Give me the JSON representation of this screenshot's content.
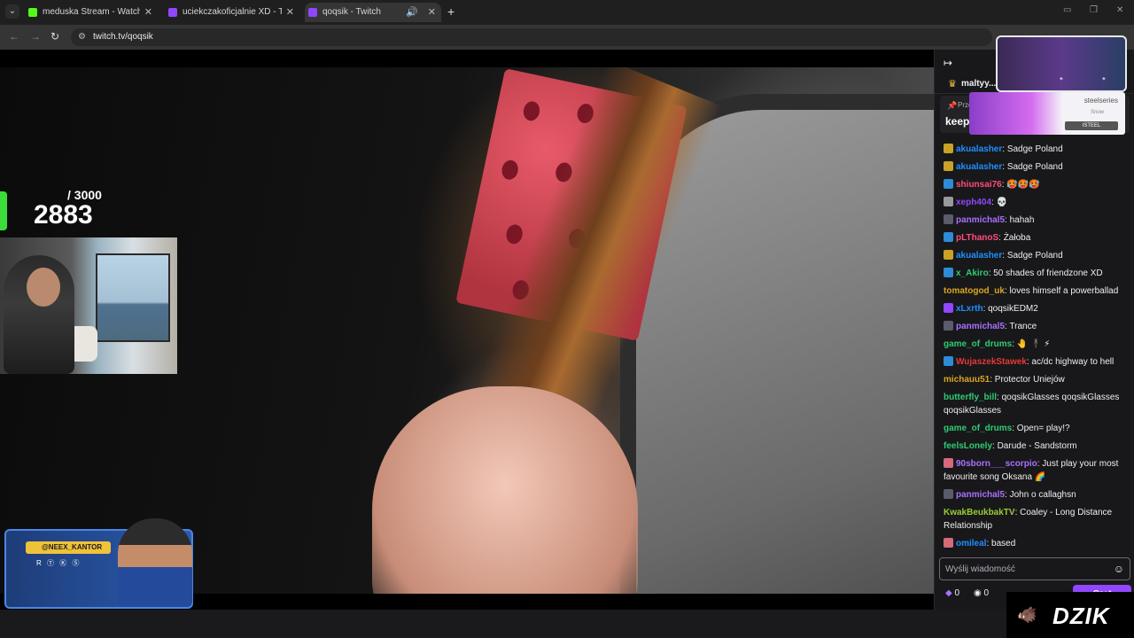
{
  "browser": {
    "tabs": [
      {
        "title": "meduska Stream - Watch Live o",
        "favicon_color": "#53fc18"
      },
      {
        "title": "uciekczakoficjalnie XD - Twitch",
        "favicon_color": "#9146ff"
      },
      {
        "title": "qoqsik - Twitch",
        "favicon_color": "#9146ff"
      }
    ],
    "url": "twitch.tv/qoqsik",
    "tab_menu_icon": "chevron-down-icon",
    "close_glyph": "✕",
    "new_tab_glyph": "+"
  },
  "stream": {
    "counter_total": "/ 3000",
    "counter_value": "2883",
    "overlay_handle": "@NEEX_KANTOR"
  },
  "chat": {
    "top_gifter": "maltyy...",
    "pinned_label": "Prze",
    "pinned_text": "keep",
    "ad": {
      "brand": "steelseries",
      "sub": "Snow",
      "button": "ISTEEL"
    },
    "messages": [
      {
        "badge": "b-gift",
        "user": "akualasher",
        "color": "#1e90ff",
        "text": ": Sadge Poland"
      },
      {
        "badge": "b-gift",
        "user": "akualasher",
        "color": "#1e90ff",
        "text": ": Sadge Poland"
      },
      {
        "badge": "b-prime",
        "user": "shiunsai76",
        "color": "#ff4d7a",
        "text": ": 🥵🥵🥵"
      },
      {
        "badge": "b-skull",
        "user": "xeph404",
        "color": "#9146ff",
        "text": ": 💀"
      },
      {
        "badge": "b-sub",
        "user": "panmichal5",
        "color": "#a970ff",
        "text": ": hahah"
      },
      {
        "badge": "b-prime",
        "user": "pLThanoS",
        "color": "#ff4d7a",
        "text": ": Żałoba"
      },
      {
        "badge": "b-gift",
        "user": "akualasher",
        "color": "#1e90ff",
        "text": ": Sadge Poland"
      },
      {
        "badge": "b-prime",
        "user": "x_Akiro",
        "color": "#2ecc71",
        "text": ": 50 shades of friendzone XD"
      },
      {
        "badge": "",
        "user": "tomatogod_uk",
        "color": "#daa520",
        "text": ": loves himself a powerballad"
      },
      {
        "badge": "b-verify",
        "user": "xLxrth",
        "color": "#1e90ff",
        "text": ": qoqsikEDM2"
      },
      {
        "badge": "b-sub",
        "user": "panmichal5",
        "color": "#a970ff",
        "text": ": Trance"
      },
      {
        "badge": "",
        "user": "game_of_drums",
        "color": "#2ecc71",
        "text": ": 🤚 🕴️ ⚡"
      },
      {
        "badge": "b-prime",
        "user": "WujaszekStawek",
        "color": "#e53935",
        "text": ": ac/dc highway to hell"
      },
      {
        "badge": "",
        "user": "michauu51",
        "color": "#daa520",
        "text": ": Protector Uniejów"
      },
      {
        "badge": "",
        "user": "butterfly_bill",
        "color": "#2ecc71",
        "text": ": qoqsikGlasses qoqsikGlasses qoqsikGlasses"
      },
      {
        "badge": "",
        "user": "game_of_drums",
        "color": "#2ecc71",
        "text": ": Open= play!?"
      },
      {
        "badge": "",
        "user": "feelsLonely",
        "color": "#2ecc71",
        "text": ": Darude - Sandstorm"
      },
      {
        "badge": "b-pink",
        "user": "90sborn___scorpio",
        "color": "#a970ff",
        "text": ": Just play your most favourite song Oksana 🌈"
      },
      {
        "badge": "b-sub",
        "user": "panmichal5",
        "color": "#a970ff",
        "text": ": John o callaghsn"
      },
      {
        "badge": "",
        "user": "KwakBeukbakTV",
        "color": "#9acd32",
        "text": ": Coaley - Long Distance Relationship"
      },
      {
        "badge": "b-pink",
        "user": "omileal",
        "color": "#1e90ff",
        "text": ": based"
      }
    ],
    "input_placeholder": "Wyślij wiadomość",
    "points_a": "0",
    "points_b": "0",
    "send_label": "Czat"
  },
  "watermark": "DZIK"
}
